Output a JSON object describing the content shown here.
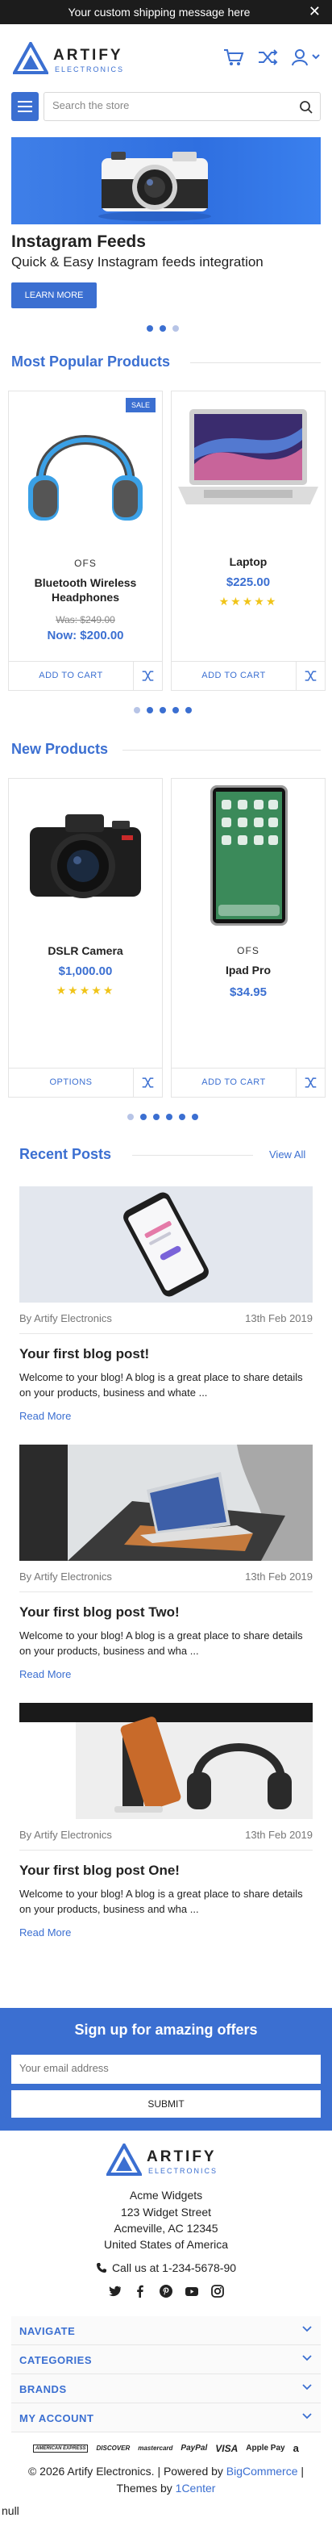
{
  "topbar": {
    "message": "Your custom shipping message here"
  },
  "logo": {
    "name": "ARTIFY",
    "tagline": "ELECTRONICS"
  },
  "search": {
    "placeholder": "Search the store"
  },
  "hero": {
    "title": "Instagram Feeds",
    "subtitle": "Quick & Easy Instagram feeds integration",
    "button": "LEARN MORE"
  },
  "popular": {
    "heading": "Most Popular Products",
    "products": [
      {
        "badge": "SALE",
        "brand": "OFS",
        "name_line1": "Bluetooth Wireless",
        "name_line2": "Headphones",
        "was": "Was: $249.00",
        "now": "Now: $200.00",
        "action": "ADD TO CART"
      },
      {
        "name": "Laptop",
        "price": "$225.00",
        "stars": "★★★★★",
        "rating": 5,
        "action": "ADD TO CART"
      }
    ]
  },
  "new_products": {
    "heading": "New Products",
    "products": [
      {
        "name": "DSLR Camera",
        "price": "$1,000.00",
        "stars": "★★★★★",
        "rating": 5,
        "action": "OPTIONS"
      },
      {
        "brand": "OFS",
        "name": "Ipad Pro",
        "price": "$34.95",
        "action": "ADD TO CART"
      }
    ]
  },
  "blog": {
    "heading": "Recent Posts",
    "view_all": "View All",
    "posts": [
      {
        "author": "By Artify Electronics",
        "date": "13th Feb 2019",
        "title": "Your first blog post!",
        "body": "Welcome to your blog! A blog is a great place to share details on your products, business and whate ...",
        "read_more": "Read More"
      },
      {
        "author": "By Artify Electronics",
        "date": "13th Feb 2019",
        "title": "Your first blog post Two!",
        "body": "Welcome to your blog! A blog is a great place to share details on your products, business and wha ...",
        "read_more": "Read More"
      },
      {
        "author": "By Artify Electronics",
        "date": "13th Feb 2019",
        "title": "Your first blog post One!",
        "body": "Welcome to your blog! A blog is a great place to share details on your products, business and wha ...",
        "read_more": "Read More"
      }
    ]
  },
  "newsletter": {
    "title": "Sign up for amazing offers",
    "placeholder": "Your email address",
    "button": "SUBMIT"
  },
  "footer": {
    "address": [
      "Acme Widgets",
      "123 Widget Street",
      "Acmeville, AC 12345",
      "United States of America"
    ],
    "phone": "Call us at 1-234-5678-90",
    "accordion": [
      "NAVIGATE",
      "CATEGORIES",
      "BRANDS",
      "MY ACCOUNT"
    ],
    "payments": [
      "AMERICAN EXPRESS",
      "DISCOVER",
      "mastercard",
      "PayPal",
      "VISA",
      "Apple Pay",
      "a"
    ],
    "copyright_prefix": "© 2026 Artify Electronics. | Powered by ",
    "copyright_link": "BigCommerce",
    "copyright_suffix": " |",
    "themes_prefix": "Themes by ",
    "themes_link": "1Center"
  },
  "trailing_text": "null",
  "colors": {
    "accent": "#3b6fd1",
    "topbar": "#1c1c1c",
    "star": "#f0c419"
  }
}
